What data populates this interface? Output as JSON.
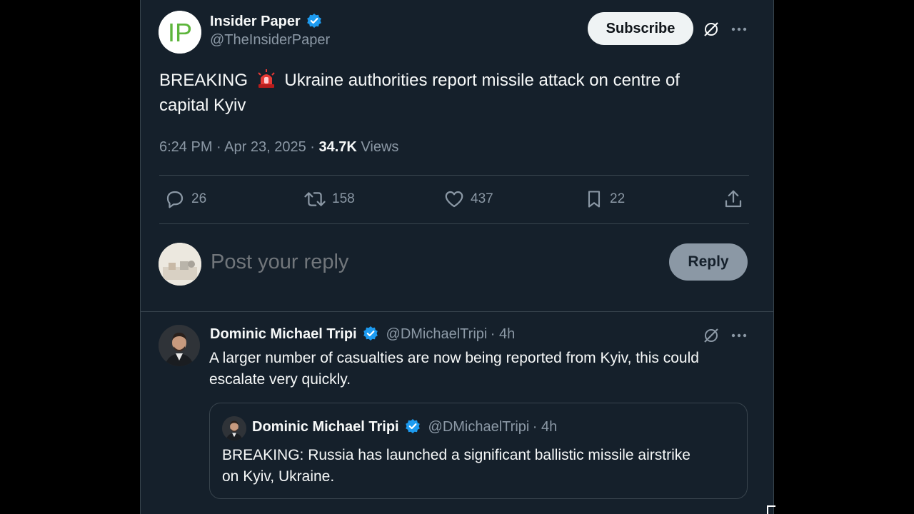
{
  "tweet": {
    "avatar_text": "IP",
    "author_name": "Insider Paper",
    "author_handle": "@TheInsiderPaper",
    "subscribe_label": "Subscribe",
    "text_prefix": "BREAKING",
    "text_emoji": "🚨",
    "text_line1": "Ukraine authorities report missile attack on centre of",
    "text_line2": "capital Kyiv",
    "time": "6:24 PM",
    "date": "Apr 23, 2025",
    "views_count": "34.7K",
    "views_label": "Views",
    "replies": "26",
    "reposts": "158",
    "likes": "437",
    "bookmarks": "22"
  },
  "composer": {
    "placeholder": "Post your reply",
    "reply_label": "Reply"
  },
  "reply": {
    "author_name": "Dominic Michael Tripi",
    "author_handle": "@DMichaelTripi",
    "time": "4h",
    "text_line1": "A larger number of casualties are now being reported from Kyiv, this could",
    "text_line2": "escalate very quickly."
  },
  "quote": {
    "author_name": "Dominic Michael Tripi",
    "author_handle": "@DMichaelTripi",
    "time": "4h",
    "text_line1": "BREAKING: Russia has launched a significant ballistic missile airstrike",
    "text_line2": "on Kyiv, Ukraine."
  },
  "colors": {
    "background": "#15202b",
    "verified": "#1d9bf0",
    "muted": "#8b98a5",
    "brand_green": "#5db53b"
  },
  "icons": [
    "verified-icon",
    "grok-icon",
    "more-icon",
    "reply-icon",
    "repost-icon",
    "like-icon",
    "bookmark-icon",
    "share-icon"
  ]
}
